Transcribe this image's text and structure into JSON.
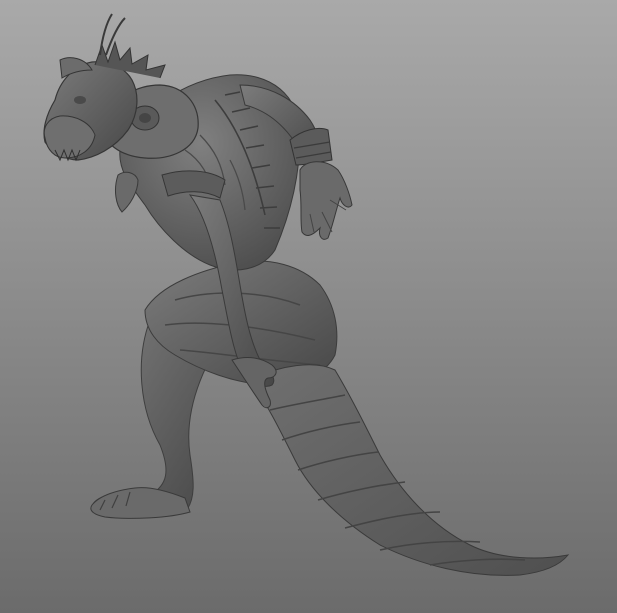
{
  "scene": {
    "subject": "creature-sculpt",
    "background_top": "#a9a9a9",
    "background_bottom": "#6b6b6b",
    "model_shade_light": "#7a7a7a",
    "model_shade_mid": "#5e5e5e",
    "model_shade_dark": "#3a3a3a"
  }
}
